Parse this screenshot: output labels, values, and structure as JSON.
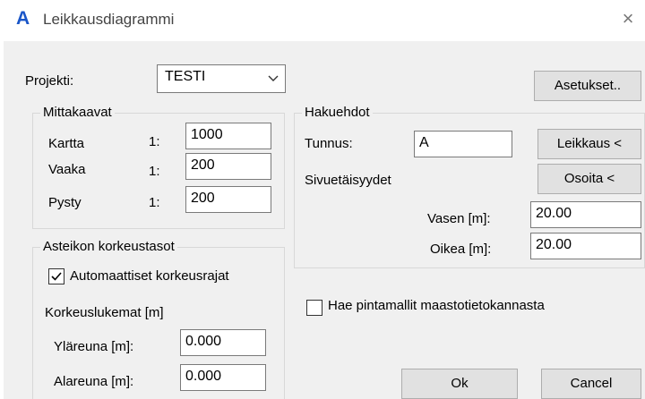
{
  "window": {
    "title": "Leikkausdiagrammi",
    "icon": "A",
    "close_glyph": "×"
  },
  "projekti": {
    "label": "Projekti:",
    "value": "TESTI",
    "settings_button": "Asetukset.."
  },
  "mittakaavat": {
    "title": "Mittakaavat",
    "rows": [
      {
        "label": "Kartta",
        "prefix": "1:",
        "value": "1000"
      },
      {
        "label": "Vaaka",
        "prefix": "1:",
        "value": "200"
      },
      {
        "label": "Pysty",
        "prefix": "1:",
        "value": "200"
      }
    ]
  },
  "hakuehdot": {
    "title": "Hakuehdot",
    "tunnus_label": "Tunnus:",
    "tunnus_value": "A",
    "leikkaus_button": "Leikkaus <",
    "sivuetaisyydet_label": "Sivuetäisyydet",
    "osoita_button": "Osoita <",
    "vasen_label": "Vasen [m]:",
    "vasen_value": "20.00",
    "oikea_label": "Oikea [m]:",
    "oikea_value": "20.00"
  },
  "asteikon": {
    "title": "Asteikon korkeustasot",
    "auto_label": "Automaattiset korkeusrajat",
    "auto_checked": true,
    "korkeuslukemat_label": "Korkeuslukemat [m]",
    "ylareuna_label": "Yläreuna [m]:",
    "ylareuna_value": "0.000",
    "alareuna_label": "Alareuna [m]:",
    "alareuna_value": "0.000"
  },
  "hae": {
    "label": "Hae pintamallit maastotietokannasta",
    "checked": false
  },
  "buttons": {
    "ok": "Ok",
    "cancel": "Cancel"
  }
}
